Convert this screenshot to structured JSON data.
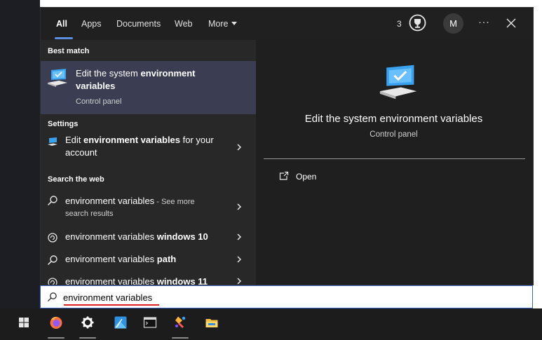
{
  "tabs": [
    {
      "label": "All",
      "active": true
    },
    {
      "label": "Apps"
    },
    {
      "label": "Documents"
    },
    {
      "label": "Web"
    },
    {
      "label": "More"
    }
  ],
  "header": {
    "points": "3",
    "rewards_icon": "trophy-icon",
    "avatar_initial": "M",
    "more_options": "···",
    "close_icon": "close-icon"
  },
  "results": {
    "best_match_header": "Best match",
    "best_match": {
      "title_line1_plain": "Edit the system ",
      "title_line1_bold": "environment",
      "title_line2_bold": "variables",
      "subtitle": "Control panel",
      "icon": "system-settings-monitor-icon"
    },
    "settings_header": "Settings",
    "settings_item": {
      "plain1": "Edit ",
      "bold": "environment variables",
      "plain2": " for your",
      "line2": "account"
    },
    "web_header": "Search the web",
    "web_items": [
      {
        "plain": "environment variables",
        "suffix": " - See more",
        "line2": "search results"
      },
      {
        "plain": "environment variables ",
        "bold": "windows 10"
      },
      {
        "plain": "environment variables ",
        "bold": "path"
      },
      {
        "plain": "environment variables ",
        "bold": "windows 11"
      }
    ]
  },
  "preview": {
    "title": "Edit the system environment variables",
    "subtitle": "Control panel",
    "open_label": "Open"
  },
  "search": {
    "value": "environment variables"
  },
  "taskbar": {
    "items": [
      "start-icon",
      "firefox-icon",
      "settings-gear-icon",
      "photos-icon",
      "terminal-icon",
      "paint-icon",
      "file-explorer-icon"
    ]
  },
  "colors": {
    "accent": "#5a8dde",
    "selected_bg": "#3b3e52",
    "panel_bg": "#202020",
    "spellcheck": "#e02020"
  }
}
